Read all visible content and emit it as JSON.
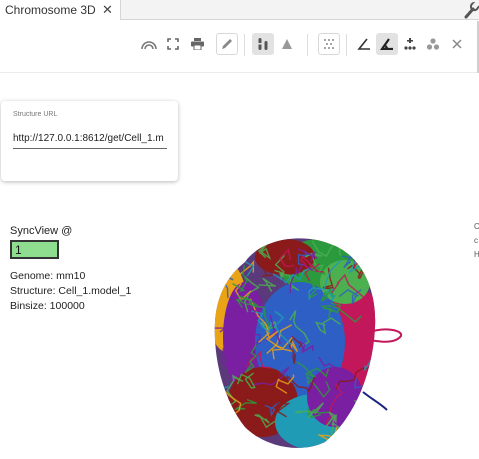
{
  "tab": {
    "title": "Chromosome 3D",
    "close_symbol": "✕"
  },
  "toolbar": {
    "buttons": [
      {
        "name": "rainbow-icon",
        "active": false
      },
      {
        "name": "fullscreen-icon",
        "active": false
      },
      {
        "name": "print-icon",
        "active": false
      },
      {
        "name": "pencil-icon",
        "active": false
      },
      {
        "name": "chromosome-icon",
        "active": true
      },
      {
        "name": "triangle-icon",
        "active": false
      },
      {
        "name": "scatter-icon",
        "active": false
      },
      {
        "name": "angle-outline-icon",
        "active": false
      },
      {
        "name": "angle-filled-icon",
        "active": true
      },
      {
        "name": "move-points-icon",
        "active": false
      },
      {
        "name": "cluster-icon",
        "active": false
      },
      {
        "name": "close-icon",
        "active": false
      }
    ]
  },
  "url_card": {
    "label": "Structure URL",
    "value": "http://127.0.0.1:8612/get/Cell_1.m"
  },
  "sync": {
    "label": "SyncView @",
    "value": "1"
  },
  "info": {
    "genome": "Genome: mm10",
    "structure": "Structure: Cell_1.model_1",
    "binsize": "Binsize: 100000"
  },
  "colors": {
    "sync_bg": "#8fdd8f",
    "chromosomes": [
      "#e8a317",
      "#2b9a3c",
      "#7a1fa2",
      "#2e5fc4",
      "#c2185b",
      "#8b1a1a",
      "#1f9bb5",
      "#4caf50"
    ]
  },
  "right_edge": [
    "C",
    "c",
    "H"
  ]
}
